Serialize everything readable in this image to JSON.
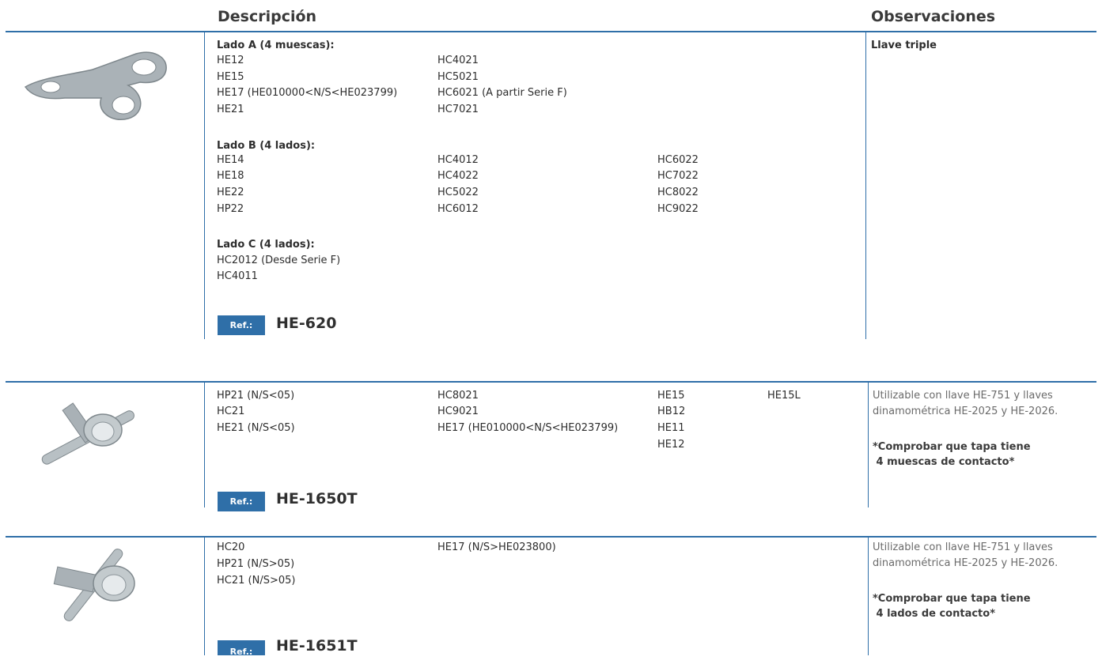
{
  "headers": {
    "descripcion": "Descripción",
    "observaciones": "Observaciones"
  },
  "products": [
    {
      "image": "triple-key-image",
      "lado_a": {
        "title": "Lado A (4 muescas):",
        "col1": [
          "HE12",
          "HE15",
          "HE17 (HE010000<N/S<HE023799)",
          "HE21"
        ],
        "col2": [
          "HC4021",
          "HC5021",
          "HC6021 (A partir Serie F)",
          "HC7021"
        ]
      },
      "lado_b": {
        "title": "Lado B (4 lados):",
        "col1": [
          "HE14",
          "HE18",
          "HE22",
          "HP22"
        ],
        "col2": [
          "HC4012",
          "HC4022",
          "HC5022",
          "HC6012"
        ],
        "col3": [
          "HC6022",
          "HC7022",
          "HC8022",
          "HC9022"
        ]
      },
      "lado_c": {
        "title": "Lado C (4 lados):",
        "col1": [
          "HC2012 (Desde Serie F)",
          "HC4011"
        ]
      },
      "ref_label": "Ref.:",
      "ref": "HE-620",
      "observation": "Llave triple"
    },
    {
      "image": "t-wrench-image",
      "col1": [
        "HP21 (N/S<05)",
        "HC21",
        "HE21 (N/S<05)"
      ],
      "col2": [
        "HC8021",
        "HC9021",
        "HE17 (HE010000<N/S<HE023799)"
      ],
      "col3": [
        "HE15",
        "HB12",
        "HE11",
        "HE12"
      ],
      "col4": [
        "HE15L"
      ],
      "ref_label": "Ref.:",
      "ref": "HE-1650T",
      "observation": "Utilizable con llave HE-751 y llaves dinamométrica HE-2025 y HE-2026.",
      "note": "*Comprobar que tapa tiene\n 4 muescas de contacto*"
    },
    {
      "image": "t-wrench-image",
      "col1": [
        "HC20",
        "HP21 (N/S>05)",
        "HC21 (N/S>05)"
      ],
      "col2": [
        "HE17 (N/S>HE023800)"
      ],
      "ref_label": "Ref.:",
      "ref": "HE-1651T",
      "observation": "Utilizable con llave HE-751 y llaves dinamométrica HE-2025 y HE-2026.",
      "note": "*Comprobar que tapa tiene\n 4 lados de contacto*"
    }
  ],
  "colors": {
    "accent": "#2f6fa8",
    "metal": "#9aa3a8"
  }
}
